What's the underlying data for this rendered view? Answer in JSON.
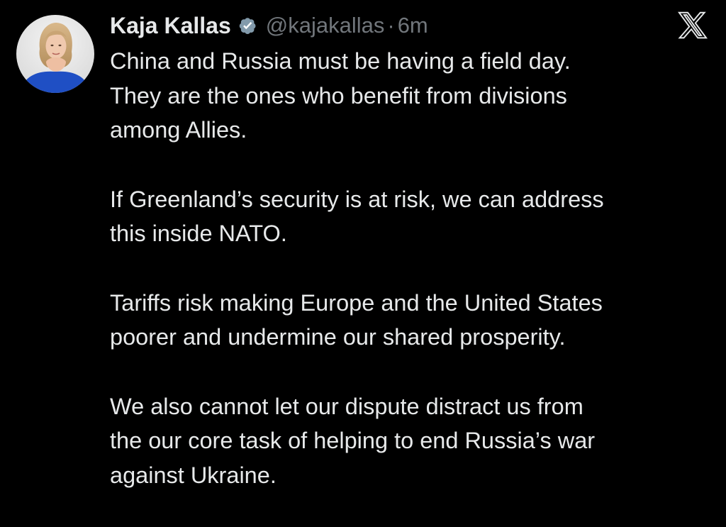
{
  "tweet": {
    "author": {
      "display_name": "Kaja Kallas",
      "handle": "@kajakallas",
      "verified_icon": "verified-badge-icon",
      "avatar_icon": "avatar-photo"
    },
    "separator": "·",
    "timestamp": "6m",
    "platform_icon": "x-logo-icon",
    "paragraphs": [
      {
        "lines": [
          "China and Russia must be having a field day.",
          "They are the ones who benefit from divisions",
          "among Allies."
        ]
      },
      {
        "lines": [
          "If Greenland’s security is at risk, we can address",
          "this inside NATO."
        ]
      },
      {
        "lines": [
          "Tariffs risk making Europe and the United States",
          "poorer and undermine our shared prosperity."
        ]
      },
      {
        "lines": [
          "We also cannot let our dispute distract us from",
          "the our core task of helping to end Russia’s war",
          "against Ukraine."
        ]
      }
    ]
  },
  "colors": {
    "background": "#000000",
    "primary_text": "#e7e9ea",
    "secondary_text": "#71767b",
    "avatar_jacket": "#1f4fc4"
  }
}
